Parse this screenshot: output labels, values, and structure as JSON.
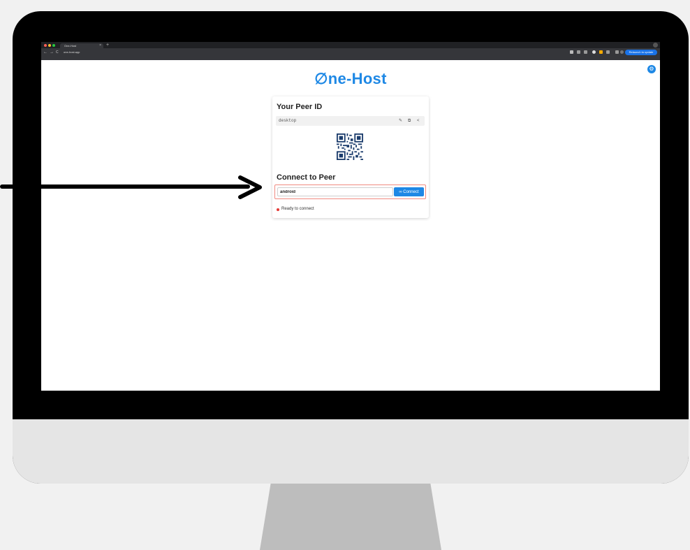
{
  "browser": {
    "tab_title": "One-Host",
    "tab_close": "×",
    "new_tab": "+",
    "url": "one-host.app",
    "relaunch_label": "Relaunch to update",
    "nav_back": "←",
    "nav_forward": "→",
    "nav_reload": "C"
  },
  "app": {
    "logo": "∅ne-Host",
    "settings_icon": "gear-icon"
  },
  "peer_card": {
    "your_peer_heading": "Your Peer ID",
    "peer_id": "desktop",
    "edit_icon": "✎",
    "copy_icon": "⧉",
    "share_icon": "<",
    "connect_heading": "Connect to Peer",
    "peer_input_value": "android",
    "connect_label": "∞ Connect",
    "status": "Ready to connect"
  },
  "colors": {
    "accent": "#1e88e5",
    "status": "#e53935",
    "highlight": "#f08a80"
  }
}
